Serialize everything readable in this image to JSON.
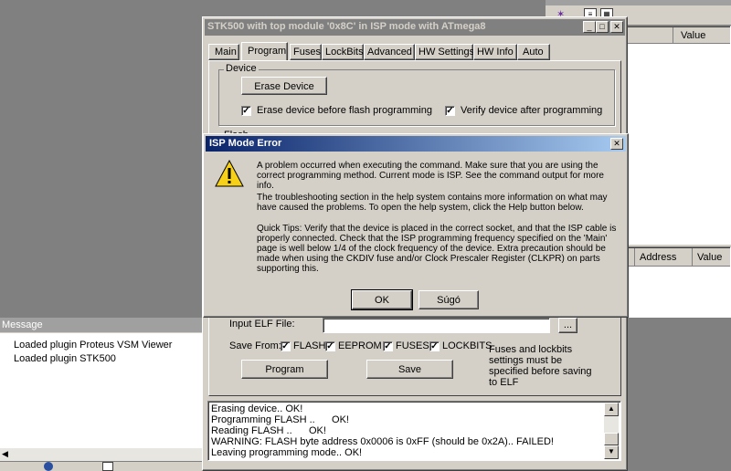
{
  "right_panel": {
    "value_header": "Value",
    "address_header": "Address",
    "value_header_2": "Value"
  },
  "message_panel": {
    "title": "Message",
    "lines": [
      "Loaded plugin Proteus VSM Viewer",
      "Loaded plugin STK500"
    ]
  },
  "stk500": {
    "title": "STK500 with top module '0x8C' in ISP mode with ATmega8",
    "tabs": [
      "Main",
      "Program",
      "Fuses",
      "LockBits",
      "Advanced",
      "HW Settings",
      "HW Info",
      "Auto"
    ],
    "active_tab": "Program",
    "device_group": "Device",
    "erase_button": "Erase Device",
    "erase_before_flash": "Erase device before flash programming",
    "verify_after": "Verify device after programming",
    "flash_group_partial": "Flash",
    "input_elf_label": "Input ELF File:",
    "browse_button": "...",
    "save_from_label": "Save From:",
    "save_from_options": [
      "FLASH",
      "EEPROM",
      "FUSES",
      "LOCKBITS"
    ],
    "fuses_note": "Fuses and lockbits settings must be specified before saving to ELF",
    "program_button": "Program",
    "save_button": "Save",
    "log": [
      "Erasing device.. OK!",
      "Programming FLASH ..      OK!",
      "Reading FLASH ..      OK!",
      "WARNING: FLASH byte address 0x0006 is 0xFF (should be 0x2A).. FAILED!",
      "Leaving programming mode.. OK!"
    ]
  },
  "dialog": {
    "title": "ISP Mode Error",
    "paragraph1": "A problem occurred when executing the command. Make sure that you are using the correct programming method. Current mode is ISP. See the command output for more info.",
    "paragraph2": "The troubleshooting section in the help system contains more information on what may have caused the problems. To open the help system, click the Help button below.",
    "paragraph3": "Quick Tips: Verify that the device is placed in the correct socket, and that the ISP cable is properly connected. Check that the ISP programming frequency specified on the 'Main' page is well below 1/4 of the clock frequency of the device. Extra precaution should be made when using the CKDIV fuse and/or Clock Prescaler Register (CLKPR) on parts supporting this.",
    "ok_button": "OK",
    "help_button": "Súgó"
  },
  "colors": {
    "title_active": "#0a246a",
    "title_inactive": "#808080",
    "desktop": "#808080",
    "face": "#d4d0c8"
  }
}
